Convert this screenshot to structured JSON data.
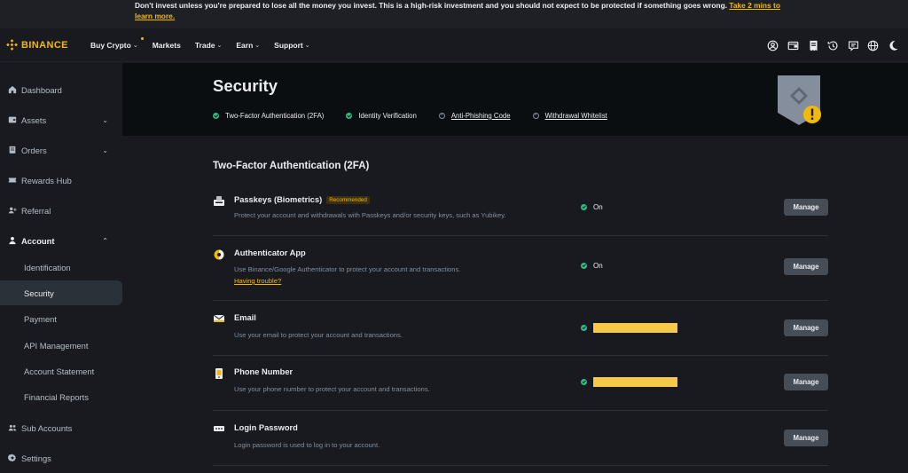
{
  "banner": {
    "text": "Don't invest unless you're prepared to lose all the money you invest. This is a high-risk investment and you should not expect to be protected if something goes wrong.",
    "link_line1": "Take 2 mins to",
    "link_line2": "learn more."
  },
  "header": {
    "logo": "BINANCE",
    "nav": [
      {
        "label": "Buy Crypto",
        "has_chevron": true,
        "badge": true
      },
      {
        "label": "Markets",
        "has_chevron": false
      },
      {
        "label": "Trade",
        "has_chevron": true
      },
      {
        "label": "Earn",
        "has_chevron": true
      },
      {
        "label": "Support",
        "has_chevron": true
      }
    ],
    "icons": [
      "user-icon",
      "wallet-icon",
      "orders-icon",
      "history-icon",
      "messages-icon",
      "globe-icon",
      "theme-icon"
    ]
  },
  "sidebar": {
    "items": [
      {
        "label": "Dashboard",
        "icon": "home-icon"
      },
      {
        "label": "Assets",
        "icon": "wallet-icon",
        "chevron": "down"
      },
      {
        "label": "Orders",
        "icon": "orders-icon",
        "chevron": "down"
      },
      {
        "label": "Rewards Hub",
        "icon": "ticket-icon"
      },
      {
        "label": "Referral",
        "icon": "add-user-icon"
      },
      {
        "label": "Account",
        "icon": "user-icon",
        "chevron": "up"
      }
    ],
    "account_sub": [
      "Identification",
      "Security",
      "Payment",
      "API Management",
      "Account Statement",
      "Financial Reports"
    ],
    "bottom_items": [
      {
        "label": "Sub Accounts",
        "icon": "users-icon"
      },
      {
        "label": "Settings",
        "icon": "gear-icon"
      }
    ]
  },
  "hero": {
    "title": "Security",
    "checks": [
      {
        "label": "Two-Factor Authentication (2FA)",
        "status": "ok"
      },
      {
        "label": "Identity Verification",
        "status": "ok"
      },
      {
        "label": "Anti-Phishing Code",
        "status": "pending"
      },
      {
        "label": "Withdrawal Whitelist",
        "status": "pending"
      }
    ]
  },
  "section": {
    "title": "Two-Factor Authentication (2FA)",
    "rows": [
      {
        "title": "Passkeys (Biometrics)",
        "badge": "Recommended",
        "desc": "Protect your account and withdrawals with Passkeys and/or security keys, such as Yubikey.",
        "status": "On",
        "button": "Manage"
      },
      {
        "title": "Authenticator App",
        "desc": "Use Binance/Google Authenticator to protect your account and transactions.",
        "link": "Having trouble?",
        "status": "On",
        "button": "Manage"
      },
      {
        "title": "Email",
        "desc": "Use your email to protect your account and transactions.",
        "status": "",
        "button": "Manage"
      },
      {
        "title": "Phone Number",
        "desc": "Use your phone number to protect your account and transactions.",
        "status": "",
        "button": "Manage"
      },
      {
        "title": "Login Password",
        "desc": "Login password is used to log in to your account.",
        "button": "Manage"
      }
    ]
  },
  "colors": {
    "accent": "#f0b90b",
    "success": "#2ebd85",
    "bg": "#181a20",
    "hero_bg": "#0b0e11"
  }
}
